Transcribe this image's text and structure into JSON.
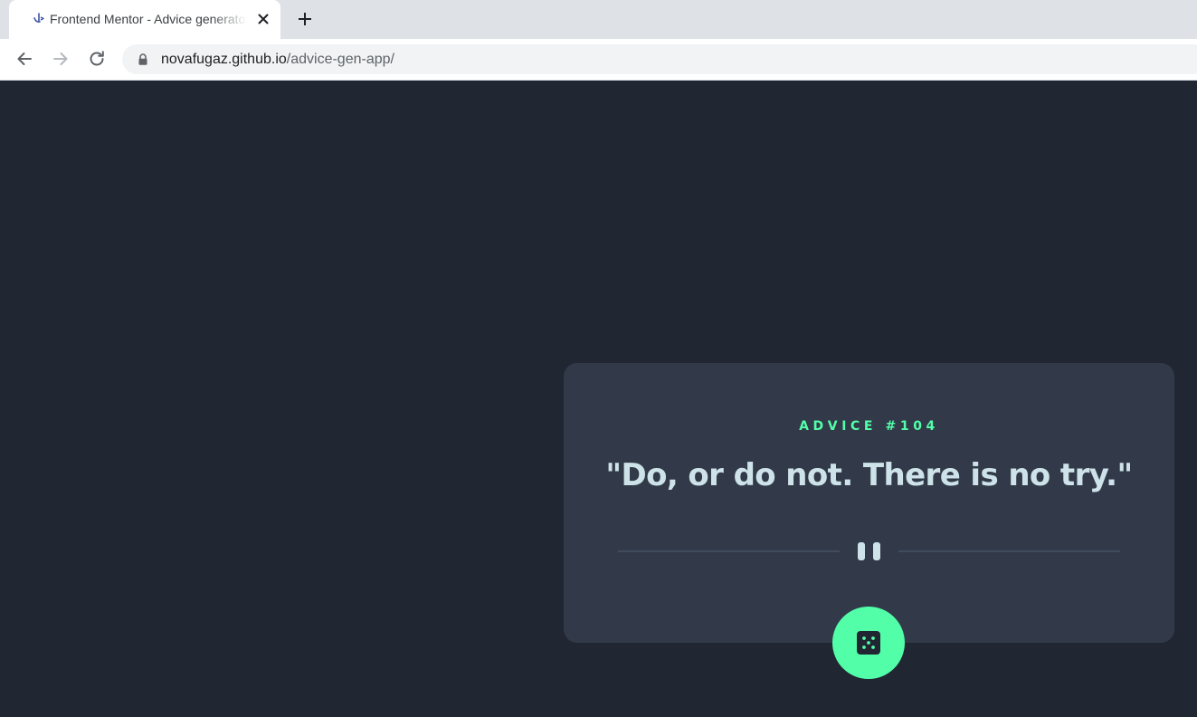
{
  "browser": {
    "tab_title": "Frontend Mentor - Advice generator app",
    "url_host": "novafugaz.github.io",
    "url_path": "/advice-gen-app/"
  },
  "advice": {
    "label": "ADVICE #104",
    "quote": "\"Do, or do not. There is no try.\""
  },
  "icons": {
    "favicon": "frontend-mentor-logo",
    "tab_close": "close-icon",
    "new_tab": "plus-icon",
    "back": "arrow-left-icon",
    "forward": "arrow-right-icon",
    "reload": "reload-icon",
    "lock": "lock-icon",
    "divider_pause": "pause-icon",
    "dice": "dice-icon"
  },
  "colors": {
    "page_background": "#202632",
    "card_background": "#323a49",
    "accent_green": "#52ffa8",
    "quote_text": "#cee3e9",
    "divider": "#4f5d74"
  }
}
